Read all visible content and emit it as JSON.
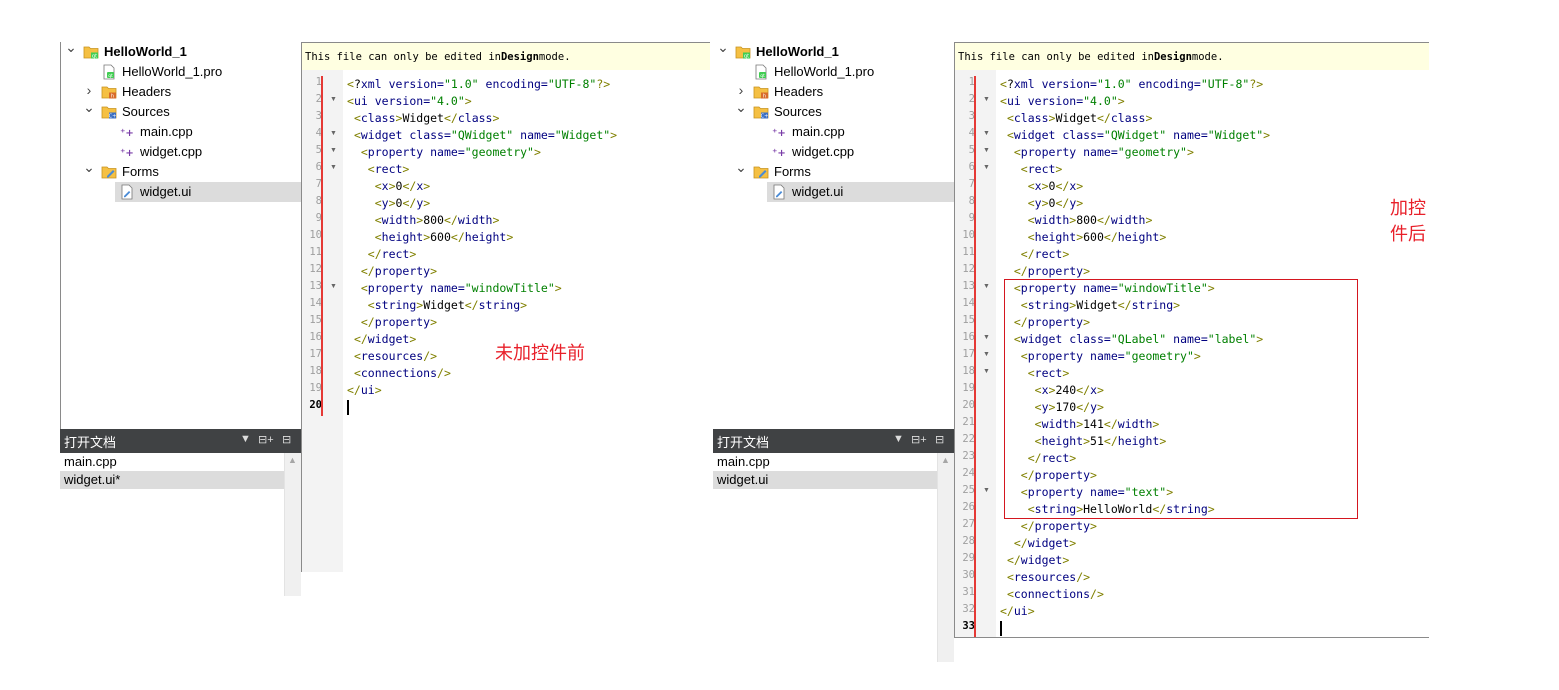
{
  "before": {
    "annotation": "未加控件前",
    "info_bar": {
      "prefix": "This file can only be edited in ",
      "bold": "Design",
      "suffix": " mode."
    },
    "tree": [
      {
        "label": "HelloWorld_1",
        "icon": "project-folder-icon",
        "arrow": "chevron-down-icon",
        "bold": true
      },
      {
        "label": "HelloWorld_1.pro",
        "icon": "pro-file-icon"
      },
      {
        "label": "Headers",
        "icon": "headers-folder-icon",
        "arrow": "chevron-right-icon"
      },
      {
        "label": "Sources",
        "icon": "sources-folder-icon",
        "arrow": "chevron-down-icon"
      },
      {
        "label": "main.cpp",
        "icon": "cpp-file-icon"
      },
      {
        "label": "widget.cpp",
        "icon": "cpp-file-icon"
      },
      {
        "label": "Forms",
        "icon": "forms-folder-icon",
        "arrow": "chevron-down-icon"
      },
      {
        "label": "widget.ui",
        "icon": "ui-file-icon",
        "selected": true
      }
    ],
    "open_docs": {
      "title": "打开文档",
      "items": [
        "main.cpp",
        "widget.ui*"
      ],
      "selected_index": 1
    },
    "code_lines": [
      "<?xml version=\"1.0\" encoding=\"UTF-8\"?>",
      "<ui version=\"4.0\">",
      " <class>Widget</class>",
      " <widget class=\"QWidget\" name=\"Widget\">",
      "  <property name=\"geometry\">",
      "   <rect>",
      "    <x>0</x>",
      "    <y>0</y>",
      "    <width>800</width>",
      "    <height>600</height>",
      "   </rect>",
      "  </property>",
      "  <property name=\"windowTitle\">",
      "   <string>Widget</string>",
      "  </property>",
      " </widget>",
      " <resources/>",
      " <connections/>",
      "</ui>",
      ""
    ],
    "fold_lines": [
      2,
      4,
      5,
      6,
      13
    ],
    "current_line": 20
  },
  "after": {
    "annotation": "加控件后",
    "info_bar": {
      "prefix": "This file can only be edited in ",
      "bold": "Design",
      "suffix": " mode."
    },
    "tree": [
      {
        "label": "HelloWorld_1",
        "icon": "project-folder-icon",
        "arrow": "chevron-down-icon",
        "bold": true
      },
      {
        "label": "HelloWorld_1.pro",
        "icon": "pro-file-icon"
      },
      {
        "label": "Headers",
        "icon": "headers-folder-icon",
        "arrow": "chevron-right-icon"
      },
      {
        "label": "Sources",
        "icon": "sources-folder-icon",
        "arrow": "chevron-down-icon"
      },
      {
        "label": "main.cpp",
        "icon": "cpp-file-icon"
      },
      {
        "label": "widget.cpp",
        "icon": "cpp-file-icon"
      },
      {
        "label": "Forms",
        "icon": "forms-folder-icon",
        "arrow": "chevron-down-icon"
      },
      {
        "label": "widget.ui",
        "icon": "ui-file-icon",
        "selected": true
      }
    ],
    "open_docs": {
      "title": "打开文档",
      "items": [
        "main.cpp",
        "widget.ui"
      ],
      "selected_index": 1
    },
    "code_lines": [
      "<?xml version=\"1.0\" encoding=\"UTF-8\"?>",
      "<ui version=\"4.0\">",
      " <class>Widget</class>",
      " <widget class=\"QWidget\" name=\"Widget\">",
      "  <property name=\"geometry\">",
      "   <rect>",
      "    <x>0</x>",
      "    <y>0</y>",
      "    <width>800</width>",
      "    <height>600</height>",
      "   </rect>",
      "  </property>",
      "  <property name=\"windowTitle\">",
      "   <string>Widget</string>",
      "  </property>",
      "  <widget class=\"QLabel\" name=\"label\">",
      "   <property name=\"geometry\">",
      "    <rect>",
      "     <x>240</x>",
      "     <y>170</y>",
      "     <width>141</width>",
      "     <height>51</height>",
      "    </rect>",
      "   </property>",
      "   <property name=\"text\">",
      "    <string>HelloWorld</string>",
      "   </property>",
      "  </widget>",
      " </widget>",
      " <resources/>",
      " <connections/>",
      "</ui>",
      ""
    ],
    "fold_lines": [
      2,
      4,
      5,
      6,
      13,
      16,
      17,
      18,
      25
    ],
    "current_line": 33
  }
}
